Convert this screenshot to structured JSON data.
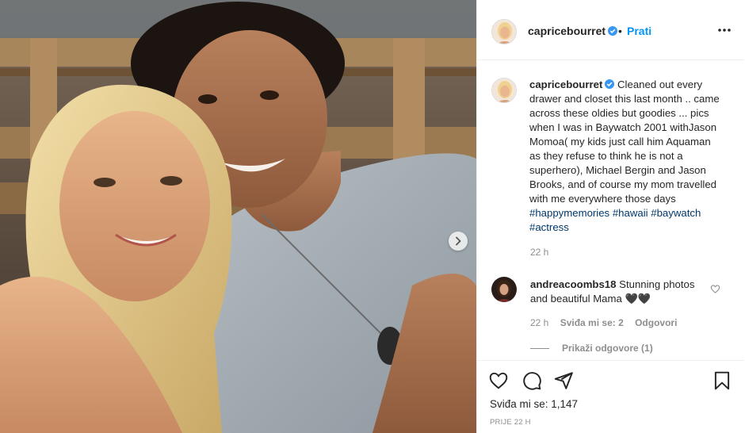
{
  "post": {
    "photo_alt": "Photo of two people smiling",
    "next_label": "Next"
  },
  "header": {
    "username": "capricebourret",
    "separator": "•",
    "follow_label": "Prati"
  },
  "caption": {
    "username": "capricebourret",
    "text_before_tags": "Cleaned out every drawer and closet this last month .. came across these oldies but goodies ... pics when I was in Baywatch 2001 withJason Momoa( my kids just call him Aquaman as they refuse to think he is not a superhero), Michael Bergin and Jason Brooks, and of course my mom travelled with me everywhere those days",
    "tags": [
      "#happymemories",
      "#hawaii",
      "#baywatch",
      "#actress"
    ],
    "time": "22 h"
  },
  "comment": {
    "username": "andreacoombs18",
    "text": "Stunning photos and beautiful Mama 🖤🖤",
    "time": "22 h",
    "likes_label": "Sviđa mi se: 2",
    "reply_label": "Odgovori",
    "view_replies": "Prikaži odgovore (1)"
  },
  "footer": {
    "likes": "Sviđa mi se: 1,147",
    "date": "PRIJE 22 H"
  },
  "colors": {
    "accent": "#0095f6",
    "hashtag": "#00376b",
    "muted": "#8e8e8e",
    "border": "#efefef"
  },
  "icons": {
    "header_more": "more-horizontal-icon",
    "verified": "verified-badge-icon",
    "next": "chevron-right-icon",
    "like": "heart-icon",
    "comment": "comment-icon",
    "share": "share-icon",
    "save": "bookmark-icon"
  }
}
